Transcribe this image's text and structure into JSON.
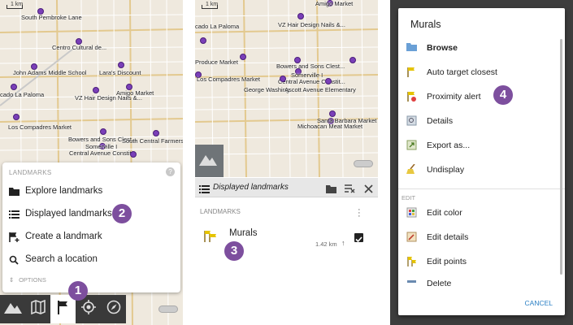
{
  "scale_label": "1 km",
  "panel1": {
    "map_labels": [
      "South Pembroke Lane",
      "Centro Cultural de...",
      "John Adams Middle School",
      "Lara's Discount",
      "Amigo Market",
      "cado La Paloma",
      "VZ Hair Design Nails &...",
      "Los Compadres Market",
      "Bowers and Sons Clest...",
      "South Central Farmers",
      "Central Avenue Constit...",
      "Ascott Avenue Elementary",
      "Somerville I"
    ],
    "menu": {
      "header": "LANDMARKS",
      "help": "?",
      "items": [
        "Explore landmarks",
        "Displayed landmarks",
        "Create a landmark",
        "Search a location"
      ],
      "options": "OPTIONS"
    },
    "badges": [
      "2",
      "1"
    ]
  },
  "panel2": {
    "map_labels": [
      "cado La Paloma",
      "VZ Hair Design Nails &...",
      "Amigo Market",
      "Produce Market",
      "Los Compadres Market",
      "Bowers and Sons Clest...",
      "Somerville I",
      "Central Avenue Constit...",
      "George Washing",
      "Ascott Avenue Elementary",
      "Santa Barbara Market",
      "Michoacan Meat Market"
    ],
    "toolbar_title": "Displayed landmarks",
    "section": "LANDMARKS",
    "item": {
      "name": "Murals",
      "distance": "1.42 km"
    },
    "badge": "3"
  },
  "panel3": {
    "dialog_title": "Murals",
    "items": [
      "Browse",
      "Auto target closest",
      "Proximity alert",
      "Details",
      "Export as...",
      "Undisplay"
    ],
    "edit_section": "EDIT",
    "edit_items": [
      "Edit color",
      "Edit details",
      "Edit points",
      "Delete"
    ],
    "cancel": "CANCEL",
    "badge": "4"
  }
}
